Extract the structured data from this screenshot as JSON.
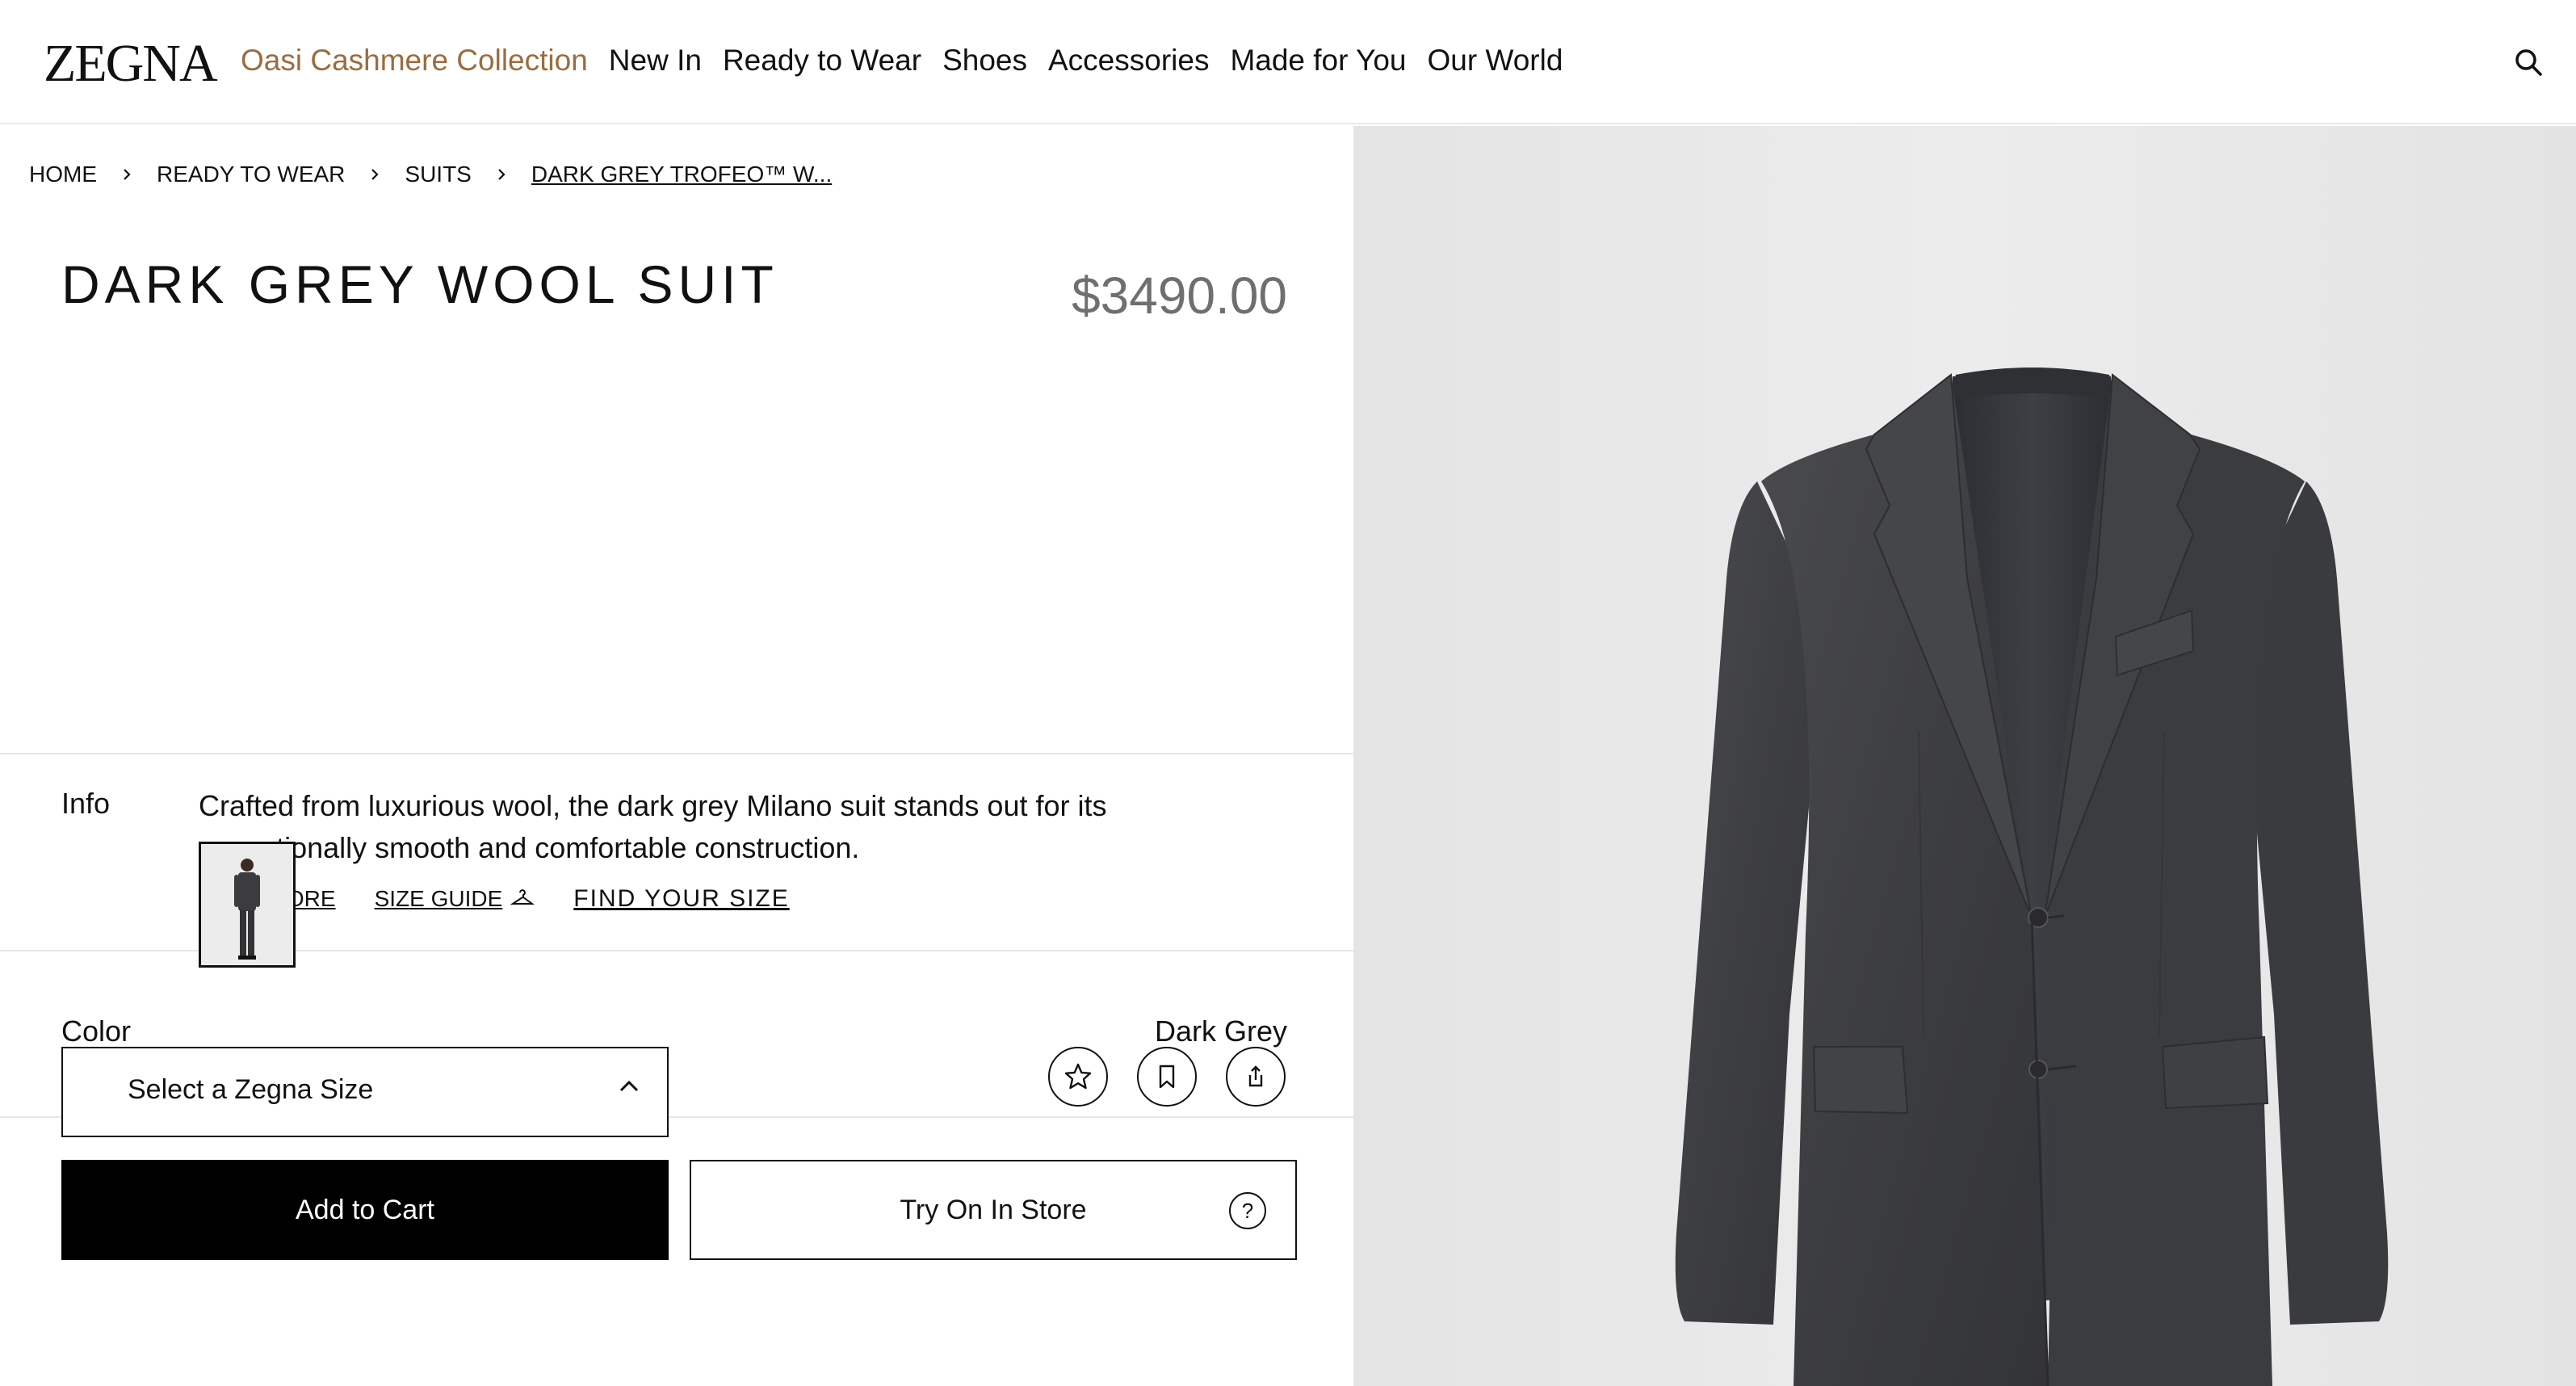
{
  "header": {
    "logo": "ZEGNA",
    "nav": [
      "Oasi Cashmere Collection",
      "New In",
      "Ready to Wear",
      "Shoes",
      "Accessories",
      "Made for You",
      "Our World"
    ],
    "accent_color": "#9b6c3e",
    "search_icon": "search-icon"
  },
  "breadcrumb": [
    "HOME",
    "READY TO WEAR",
    "SUITS",
    "DARK GREY TROFEO™ W..."
  ],
  "product": {
    "title": "DARK GREY WOOL SUIT",
    "price": "$3490.00",
    "info_label": "Info",
    "info_text": "Crafted from luxurious wool, the dark grey Milano suit stands out for its exceptionally smooth and comfortable construction.",
    "read_more": "READ MORE",
    "size_guide": "SIZE GUIDE",
    "find_your_size": "FIND YOUR SIZE",
    "color_label": "Color",
    "color_value": "Dark Grey",
    "size_select": "Select a Zegna Size",
    "add_to_cart": "Add to Cart",
    "try_on": "Try On In Store",
    "help": "?"
  },
  "icons": {
    "favorite": "star-icon",
    "save": "bookmark-icon",
    "share": "share-icon",
    "size_guide": "hanger-icon"
  }
}
